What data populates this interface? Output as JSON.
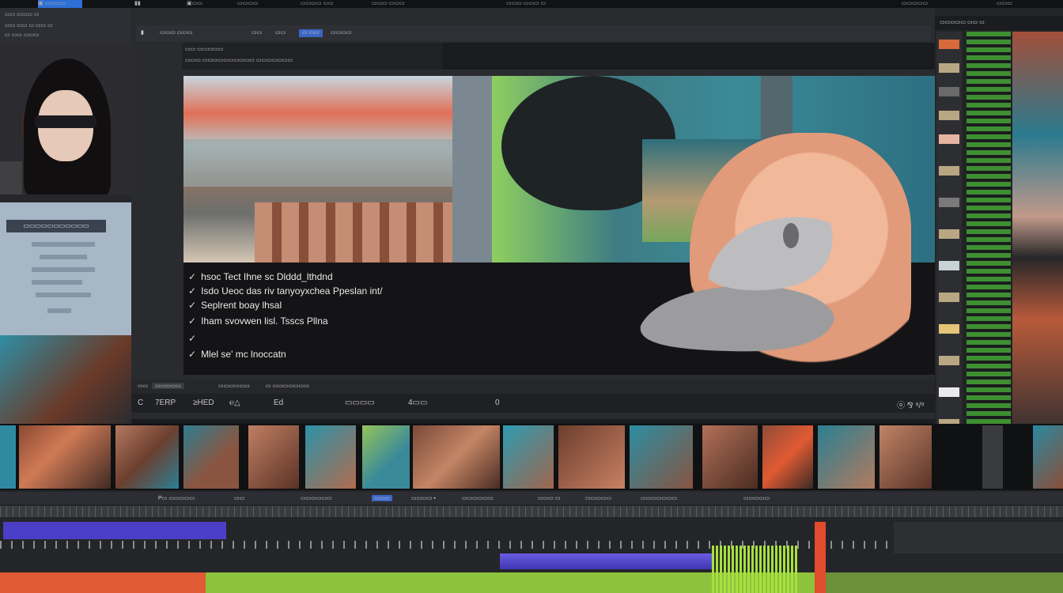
{
  "top_bar": {
    "items": [
      "▣ ▭▭▭▭",
      "▮▮",
      "▣▭▭",
      "▭▭▭▭",
      "▭▭▭▭ ▭▭",
      "▭▭▭ ▭▭▭",
      "▭▭▭ ▭▭▭ ▭",
      "▭▭▭▭▭",
      "▭▭▭"
    ]
  },
  "left_panel": {
    "header_rows": [
      "▭▭ ▭▭▭ ▭",
      "▭▭ ▭▭ ▭ ▭▭ ▭",
      "▭ ▭▭ ▭▭▭"
    ],
    "info_title": "▭▭▭▭▭▭▭▭▭▭▭"
  },
  "viewer": {
    "toolbar": [
      "▮",
      "▭▭▭ ▭▭▭",
      "▭▭",
      "▭▭",
      "▭ ▭▭",
      "▭▭▭▭"
    ],
    "subheader": [
      "▭▭ ▭▭▭▭▭",
      "▭▭▭ ▭▭▭▭▭▭▭▭▭▭ ▭▭▭▭▭▭▭"
    ],
    "checklist": [
      "hsoc Tect Ihne sc Dlddd_lthdnd",
      "Isdo Ueoc das riv tanyoyxchea Ppeslan int/",
      "Seplrent boay lhsal",
      "Iham svovwen lisl. Tsscs Pllna",
      "",
      "Mlel se' mc lnoccatn"
    ],
    "status_bar": [
      "▭▭",
      "▭▭▭▭▭",
      "▭▭▭▭▭▭",
      "▭ ▭▭▭▭▭▭▭"
    ],
    "transport": [
      "C",
      "7ERP",
      "≥HED",
      "℮△",
      "Ed",
      "▭▭▭▭",
      "4▭▭",
      "0"
    ],
    "transport_right": "ⓞ ⅋ ⁹/⁹"
  },
  "right_panel": {
    "top": "▭▭▭▭▭ ▭▭ ▭"
  },
  "timeline": {
    "header": [
      "P▭ ▭▭▭▭▭",
      "▭▭",
      "▭▭▭▭▭▭",
      "▭▭▭",
      "▭▭▭▭ ▪",
      "▭▭▭▭▭▭",
      "▭▭▭ ▭",
      "▭▭▭▭▭",
      "▭▭▭▭▭▭▭",
      "▭▭▭▭▭"
    ]
  },
  "colors": {
    "accent_blue": "#2c6fd6",
    "video_track": "#4b3fc7",
    "audio_green": "#8dc23c",
    "audio_orange": "#e05a33",
    "playhead": "#e14b2e"
  }
}
